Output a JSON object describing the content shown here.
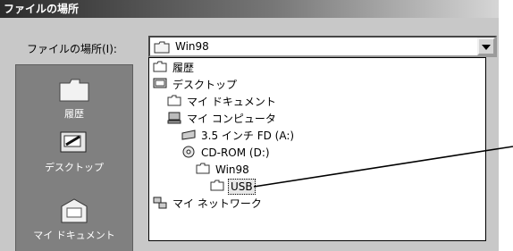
{
  "window": {
    "title": "ファイルの場所"
  },
  "look_in": {
    "label": "ファイルの場所(I):",
    "value": "Win98"
  },
  "places_bar": [
    {
      "label": "履歴",
      "icon": "history-folder-icon"
    },
    {
      "label": "デスクトップ",
      "icon": "desktop-icon"
    },
    {
      "label": "マイ ドキュメント",
      "icon": "my-documents-icon"
    }
  ],
  "dropdown_items": [
    {
      "label": "履歴",
      "icon": "folder-icon"
    },
    {
      "label": "デスクトップ",
      "icon": "desktop-icon"
    },
    {
      "label": "マイ ドキュメント",
      "icon": "folder-icon"
    },
    {
      "label": "マイ コンピュータ",
      "icon": "computer-icon"
    },
    {
      "label": "3.5 インチ FD (A:)",
      "icon": "floppy-drive-icon"
    },
    {
      "label": "CD-ROM (D:)",
      "icon": "cd-rom-icon"
    },
    {
      "label": "Win98",
      "icon": "folder-icon"
    },
    {
      "label": "USB",
      "icon": "folder-icon",
      "selected": true
    },
    {
      "label": "マイ ネットワーク",
      "icon": "network-icon"
    }
  ]
}
